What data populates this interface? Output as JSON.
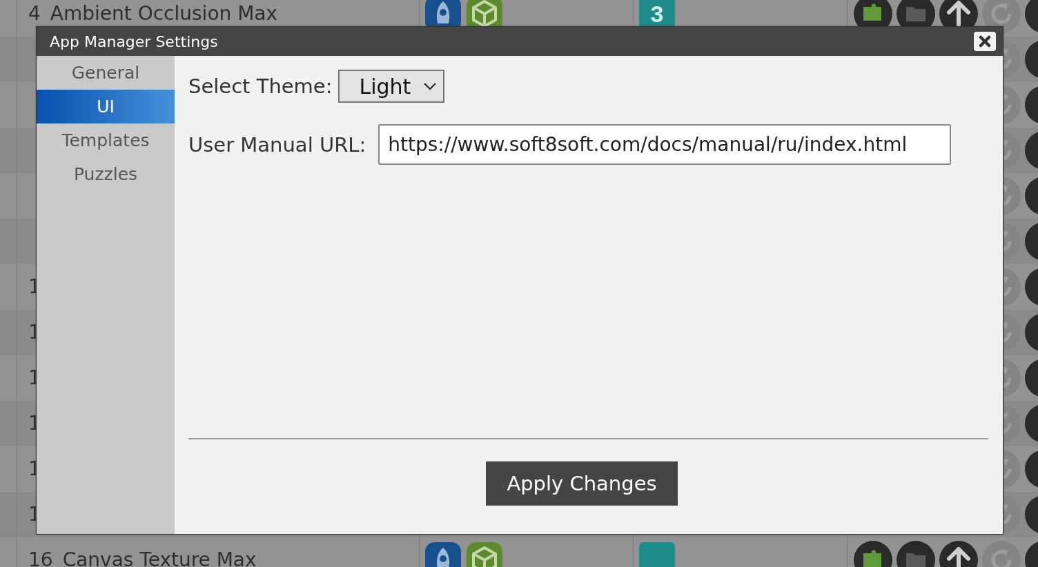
{
  "background_table": {
    "rows": [
      {
        "kind": "full",
        "number": "4",
        "name": "Ambient Occlusion Max",
        "badge": "3"
      },
      {
        "kind": "covered"
      },
      {
        "kind": "covered"
      },
      {
        "kind": "covered"
      },
      {
        "kind": "covered"
      },
      {
        "kind": "covered"
      },
      {
        "kind": "covered",
        "number": "1"
      },
      {
        "kind": "covered",
        "number": "1"
      },
      {
        "kind": "covered",
        "number": "1"
      },
      {
        "kind": "covered",
        "number": "1"
      },
      {
        "kind": "covered",
        "number": "1"
      },
      {
        "kind": "covered",
        "number": "1"
      },
      {
        "kind": "full",
        "number": "16",
        "name": "Canvas Texture Max"
      }
    ]
  },
  "dialog": {
    "title": "App Manager Settings",
    "sidebar": {
      "items": [
        {
          "label": "General",
          "selected": false
        },
        {
          "label": "UI",
          "selected": true
        },
        {
          "label": "Templates",
          "selected": false
        },
        {
          "label": "Puzzles",
          "selected": false
        }
      ]
    },
    "theme": {
      "label": "Select Theme:",
      "value": "Light"
    },
    "manual_url": {
      "label": "User Manual URL:",
      "value": "https://www.soft8soft.com/docs/manual/ru/index.html"
    },
    "apply_button": "Apply Changes"
  }
}
